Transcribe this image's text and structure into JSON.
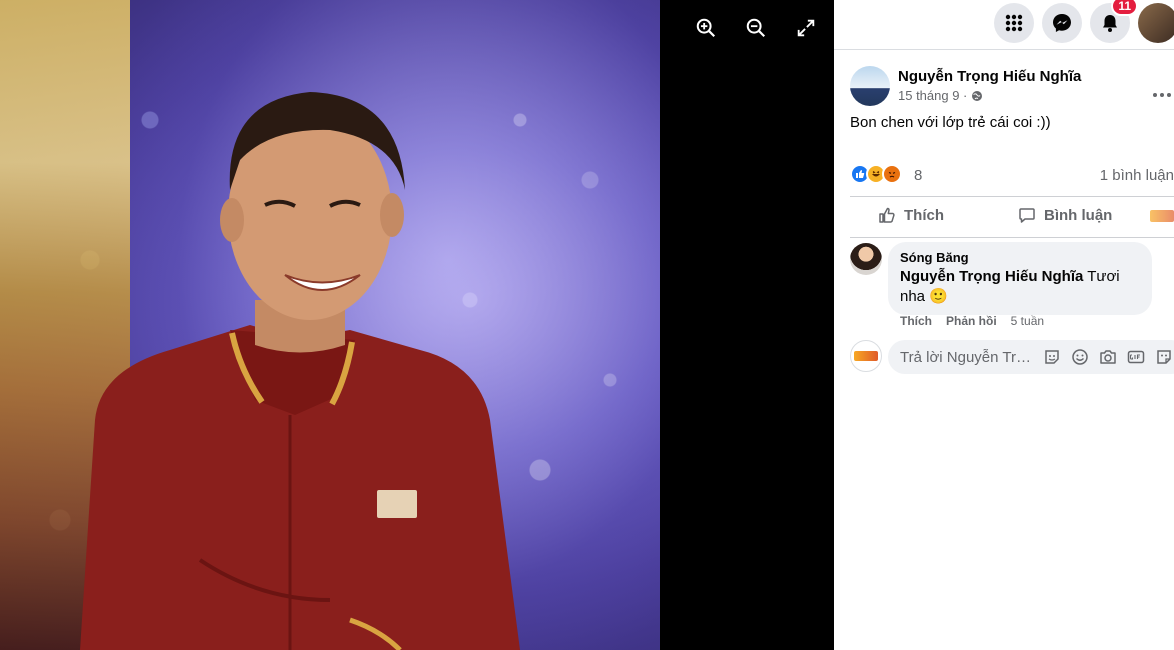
{
  "viewer": {
    "zoom_in_icon": "zoom-in-icon",
    "zoom_out_icon": "zoom-out-icon",
    "fullscreen_icon": "fullscreen-icon"
  },
  "topbar": {
    "menu_icon": "grid-menu-icon",
    "messenger_icon": "messenger-icon",
    "notifications_icon": "bell-icon",
    "notification_count": "11"
  },
  "post": {
    "author": "Nguyễn Trọng Hiếu Nghĩa",
    "date": "15 tháng 9 ·",
    "privacy_icon": "globe-icon",
    "text": "Bon chen với lớp trẻ cái coi :))",
    "reaction_count": "8",
    "comment_count": "1 bình luận",
    "like_label": "Thích",
    "comment_label": "Bình luận"
  },
  "comment": {
    "author": "Sóng Băng",
    "mention": "Nguyễn Trọng Hiếu Nghĩa",
    "text": " Tươi nha 🙂",
    "like": "Thích",
    "reply": "Phản hồi",
    "time": "5 tuần"
  },
  "reply_box": {
    "placeholder": "Trả lời Nguyễn Trọng Hiếu Nghĩa..."
  },
  "colors": {
    "accent": "#1877f2",
    "badge": "#e41e3f",
    "text_secondary": "#65676b"
  }
}
